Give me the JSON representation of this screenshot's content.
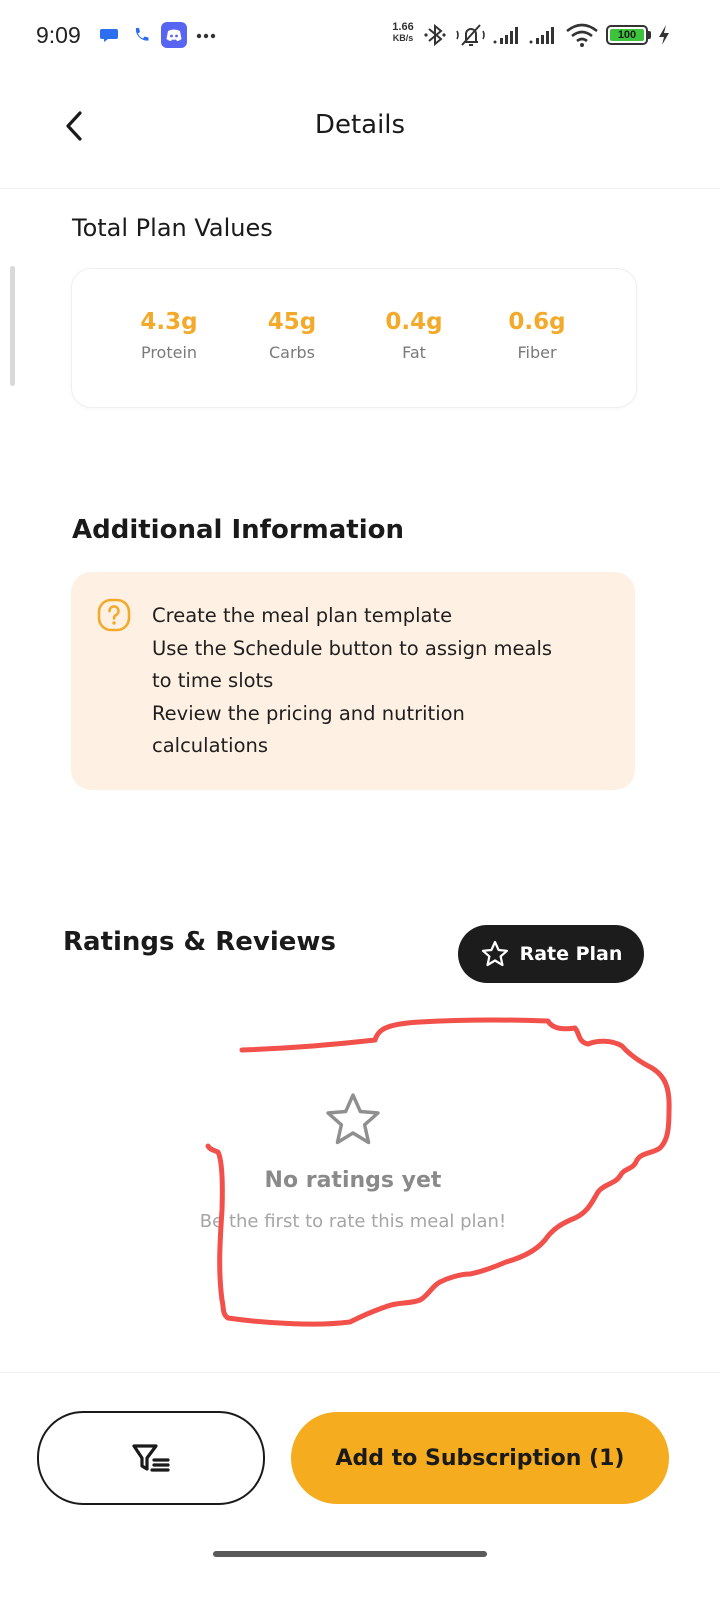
{
  "status_bar": {
    "time": "9:09",
    "net_speed_value": "1.66",
    "net_speed_unit": "KB/s",
    "battery": "100",
    "left_icons": [
      "chat-bubble-icon",
      "phone-icon",
      "discord-icon",
      "more-dots-icon"
    ],
    "right_icons": [
      "bluetooth-icon",
      "mute-icon",
      "signal-icon",
      "signal-icon",
      "wifi-icon",
      "battery-icon",
      "charging-bolt-icon"
    ]
  },
  "header": {
    "title": "Details",
    "back_icon": "chevron-left-icon"
  },
  "plan_values": {
    "title": "Total Plan Values",
    "nutrients": [
      {
        "value": "4.3g",
        "label": "Protein"
      },
      {
        "value": "45g",
        "label": "Carbs"
      },
      {
        "value": "0.4g",
        "label": "Fat"
      },
      {
        "value": "0.6g",
        "label": "Fiber"
      }
    ],
    "value_color": "#f3a92a"
  },
  "additional_info": {
    "title": "Additional Information",
    "icon": "question-circle-icon",
    "lines": [
      "Create the meal plan template",
      "Use the Schedule button to assign meals",
      "to time slots",
      "Review the pricing and nutrition",
      "calculations"
    ],
    "background_color": "#fef1e4"
  },
  "ratings": {
    "title": "Ratings & Reviews",
    "rate_button_label": "Rate Plan",
    "rate_button_icon": "star-outline-icon",
    "empty_title": "No ratings yet",
    "empty_subtitle": "Be the first to rate this meal plan!",
    "empty_icon": "star-outline-icon"
  },
  "bottom_bar": {
    "filter_icon": "filter-list-icon",
    "subscribe_label": "Add to Subscription (1)",
    "accent_color": "#f5ac1f"
  }
}
